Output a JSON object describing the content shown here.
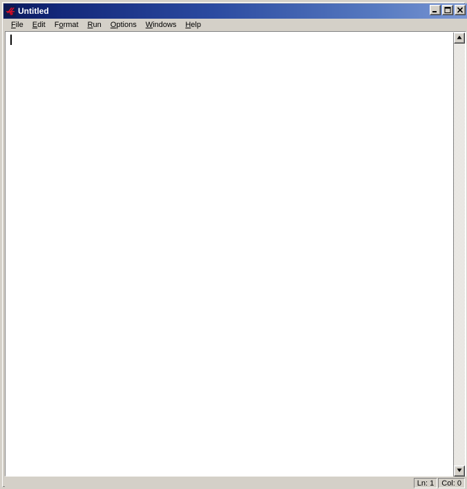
{
  "window": {
    "title": "Untitled",
    "icon": "python-idle-icon",
    "colors": {
      "titlebar_gradient_start": "#0a1a5c",
      "titlebar_gradient_end": "#7a97d4",
      "face": "#d4d0c8",
      "text_area_bg": "#ffffff",
      "icon_red": "#c8102e",
      "icon_blue": "#1b2a6b"
    },
    "controls": {
      "minimize_label": "Minimize",
      "maximize_label": "Maximize",
      "close_label": "Close"
    }
  },
  "menubar": {
    "items": [
      {
        "label": "File",
        "before": "",
        "accel": "F",
        "after": "ile"
      },
      {
        "label": "Edit",
        "before": "",
        "accel": "E",
        "after": "dit"
      },
      {
        "label": "Format",
        "before": "F",
        "accel": "o",
        "after": "rmat"
      },
      {
        "label": "Run",
        "before": "",
        "accel": "R",
        "after": "un"
      },
      {
        "label": "Options",
        "before": "",
        "accel": "O",
        "after": "ptions"
      },
      {
        "label": "Windows",
        "before": "",
        "accel": "W",
        "after": "indows"
      },
      {
        "label": "Help",
        "before": "",
        "accel": "H",
        "after": "elp"
      }
    ]
  },
  "editor": {
    "content": "",
    "caret_visible": true
  },
  "scrollbar": {
    "up_arrow": "scroll-up-arrow-icon",
    "down_arrow": "scroll-down-arrow-icon",
    "thumb_visible": false
  },
  "statusbar": {
    "line_label": "Ln: 1",
    "col_label": "Col: 0"
  }
}
